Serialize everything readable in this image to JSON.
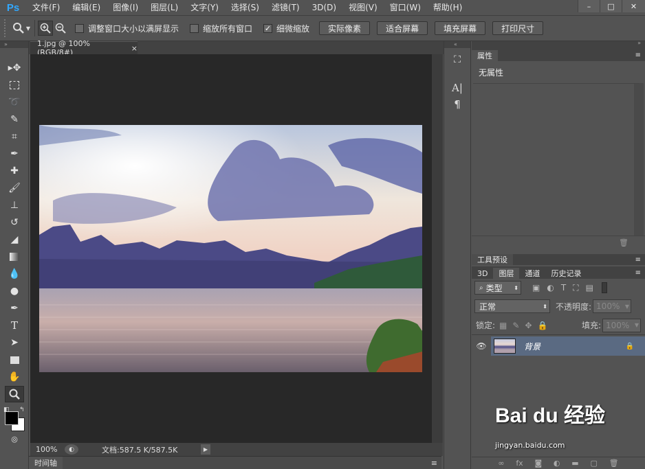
{
  "app": {
    "logo": "Ps"
  },
  "menu": [
    "文件(F)",
    "编辑(E)",
    "图像(I)",
    "图层(L)",
    "文字(Y)",
    "选择(S)",
    "滤镜(T)",
    "3D(D)",
    "视图(V)",
    "窗口(W)",
    "帮助(H)"
  ],
  "window_controls": {
    "minimize": "–",
    "maximize": "□",
    "close": "✕"
  },
  "options": {
    "resize_windows_label": "调整窗口大小以满屏显示",
    "zoom_all_label": "缩放所有窗口",
    "scrubby_zoom_label": "细微缩放",
    "actual_pixels": "实际像素",
    "fit_screen": "适合屏幕",
    "fill_screen": "填充屏幕",
    "print_size": "打印尺寸"
  },
  "document": {
    "tab_title": "1.jpg @ 100%(RGB/8#)",
    "close": "×"
  },
  "status": {
    "zoom": "100%",
    "doc_info": "文档:587.5 K/587.5K"
  },
  "timeline": {
    "label": "时间轴"
  },
  "properties": {
    "tab": "属性",
    "content": "无属性"
  },
  "tool_presets": {
    "tab": "工具预设"
  },
  "layers_panel": {
    "tabs": [
      "3D",
      "图层",
      "通道",
      "历史记录"
    ],
    "filter_kind": "类型",
    "blend_mode": "正常",
    "opacity_label": "不透明度:",
    "opacity_value": "100%",
    "lock_label": "锁定:",
    "fill_label": "填充:",
    "fill_value": "100%",
    "layer_name": "背景"
  },
  "watermark": {
    "text": "Bai du 经验",
    "url": "jingyan.baidu.com"
  },
  "colors": {
    "accent": "#31a8ff",
    "selected_layer": "#5a6a82",
    "canvas_bg": "#282828",
    "panel_bg": "#535353"
  }
}
